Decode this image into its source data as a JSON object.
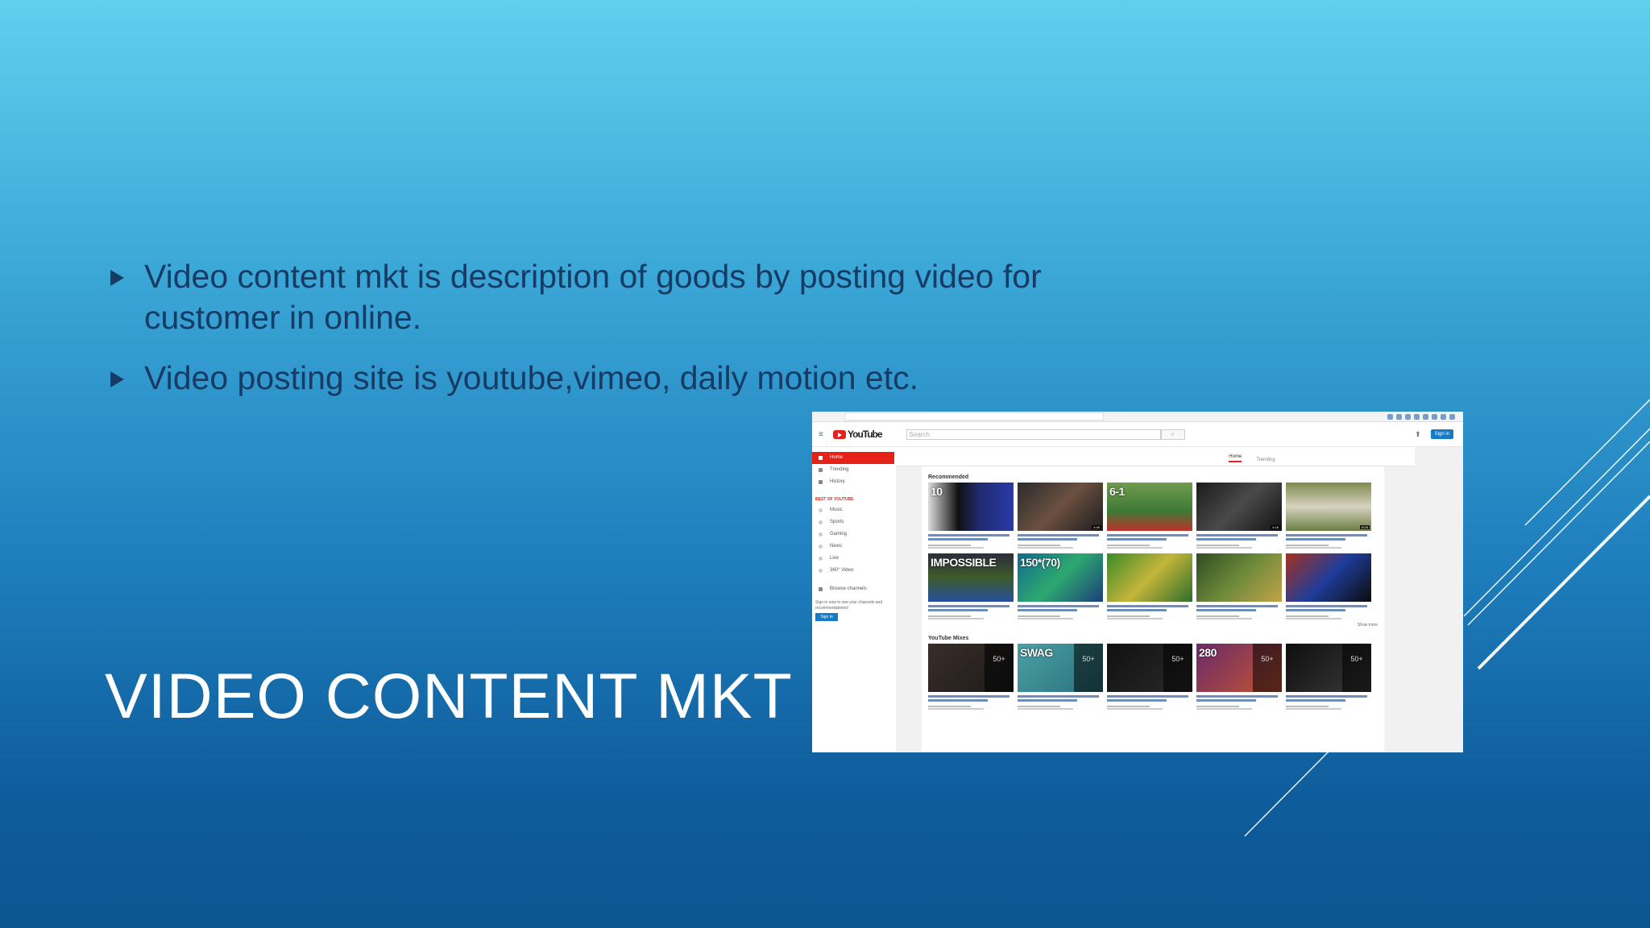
{
  "slide": {
    "title": "VIDEO CONTENT MKT",
    "bullets": [
      "Video content mkt is description of goods by posting video for customer in online.",
      "Video posting site is youtube,vimeo, daily motion etc."
    ]
  },
  "screenshot": {
    "logo_text": "YouTube",
    "search_placeholder": "Search",
    "tabs": [
      "Home",
      "Trending"
    ],
    "sidebar": [
      {
        "label": "Home",
        "active": true
      },
      {
        "label": "Trending",
        "active": false
      },
      {
        "label": "History",
        "active": false
      }
    ],
    "section_label": "BEST OF YOUTUBE",
    "subs": [
      "Music",
      "Sports",
      "Gaming",
      "News",
      "Live",
      "360° Video"
    ],
    "browse_label": "Browse channels",
    "signin_note": "Sign in now to see your channels and recommendations!",
    "signin_button": "Sign in",
    "shelf1_title": "Recommended",
    "shelf2_title": "YouTube Mixes",
    "show_more": "Show more",
    "row1_thumbs": [
      {
        "dur": "",
        "big": "10",
        "bg": "linear-gradient(90deg,#ddd 0%,#111 35%,#202a6e 60%,#2b3aa8 100%)"
      },
      {
        "dur": "4:46",
        "big": "",
        "bg": "linear-gradient(135deg,#2c2c2c,#6b5040,#1d1d1d)"
      },
      {
        "dur": "",
        "big": "6-1",
        "bg": "linear-gradient(180deg,#6f9b4e 0%,#3e7a35 60%,#c0302a 100%)"
      },
      {
        "dur": "4:18",
        "big": "",
        "bg": "linear-gradient(135deg,#1c1c1c,#4a4a4a,#121212)"
      },
      {
        "dur": "8:25",
        "big": "",
        "bg": "linear-gradient(180deg,#7e8b4f,#d8d2c0,#6a7e43)"
      }
    ],
    "row2_thumbs": [
      {
        "dur": "",
        "big": "IMPOSSIBLE",
        "bg": "linear-gradient(180deg,#2d2d3a,#3c5b2a,#264f9e)"
      },
      {
        "dur": "",
        "big": "150*(70)",
        "bg": "linear-gradient(135deg,#0f6b8e,#2ea86f,#1b3f7a)"
      },
      {
        "dur": "",
        "big": "",
        "bg": "linear-gradient(135deg,#3c8a2a,#c4b53a,#2d6e2b)"
      },
      {
        "dur": "",
        "big": "",
        "bg": "linear-gradient(135deg,#2f4b23,#6d8a3a,#c2a24a)"
      },
      {
        "dur": "",
        "big": "",
        "bg": "linear-gradient(135deg,#a4321f,#1f3d9a,#0c0c0c)"
      }
    ],
    "row3_thumbs": [
      {
        "dur": "",
        "big": "",
        "mix": "50+",
        "bg": "linear-gradient(135deg,#3a2d28,#1b1b1b)"
      },
      {
        "dur": "",
        "big": "SWAG",
        "mix": "50+",
        "bg": "linear-gradient(135deg,#4aa0a6,#2b6f79)"
      },
      {
        "dur": "",
        "big": "",
        "mix": "50+",
        "bg": "linear-gradient(135deg,#111,#2a2a2a)"
      },
      {
        "dur": "",
        "big": "280",
        "mix": "50+",
        "bg": "linear-gradient(135deg,#6b2a6a,#c4562f)"
      },
      {
        "dur": "",
        "big": "",
        "mix": "50+",
        "bg": "linear-gradient(135deg,#0e0e0e,#3a3a3a)"
      }
    ]
  }
}
